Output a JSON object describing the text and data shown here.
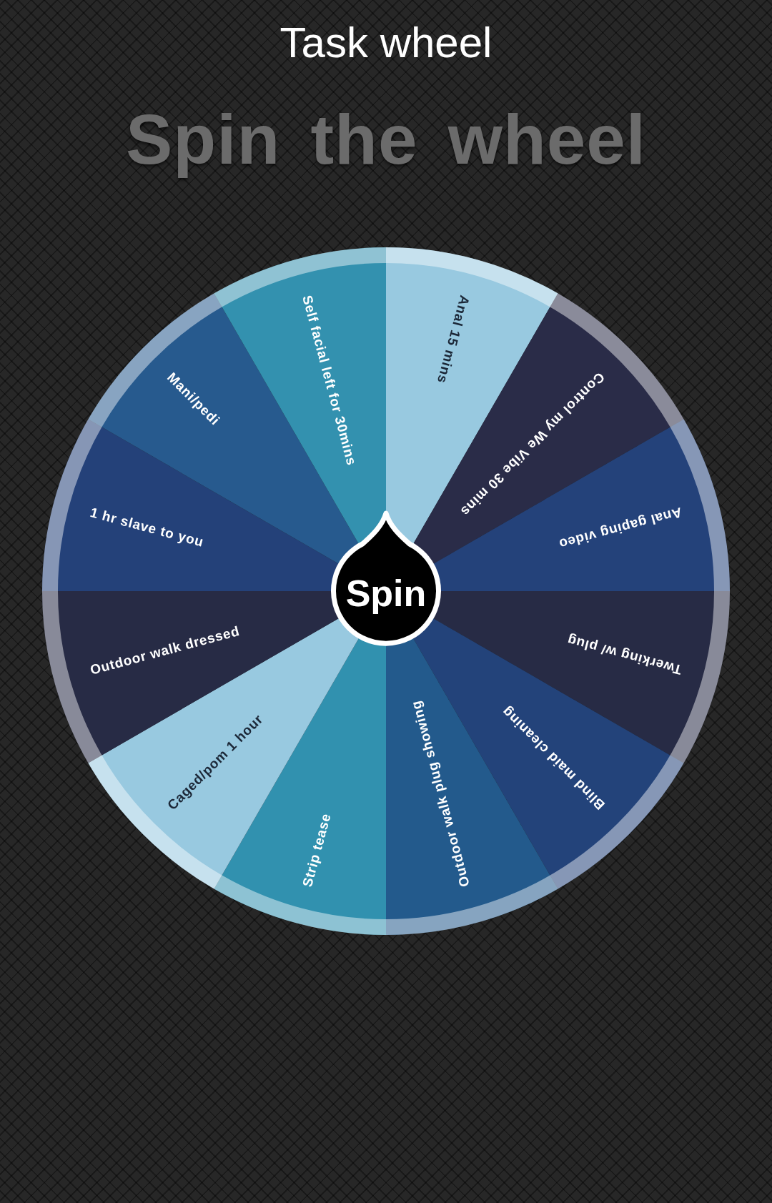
{
  "header": {
    "title": "Task wheel"
  },
  "heading": "Spin the wheel",
  "wheel": {
    "segments": [
      {
        "label": "Anal 15 mins",
        "color": "#98c9e0"
      },
      {
        "label": "Control my We Vibe 30 mins",
        "color": "#2a2c48"
      },
      {
        "label": "Anal gaping video",
        "color": "#24427a"
      },
      {
        "label": "Twerking w/ plug",
        "color": "#272b45"
      },
      {
        "label": "Blind maid cleaning",
        "color": "#23437a"
      },
      {
        "label": "Outdoor walk plug showing",
        "color": "#235a8c"
      },
      {
        "label": "Strip tease",
        "color": "#3191af"
      },
      {
        "label": "Caged/pom 1 hour",
        "color": "#98c9e0"
      },
      {
        "label": "Outdoor walk dressed",
        "color": "#272b45"
      },
      {
        "label": "1 hr slave to you",
        "color": "#244179"
      },
      {
        "label": "Mani/pedi",
        "color": "#275a8e"
      },
      {
        "label": "Self facial left for 30mins",
        "color": "#3391af"
      }
    ],
    "spin_button": {
      "label": "Spin"
    }
  }
}
